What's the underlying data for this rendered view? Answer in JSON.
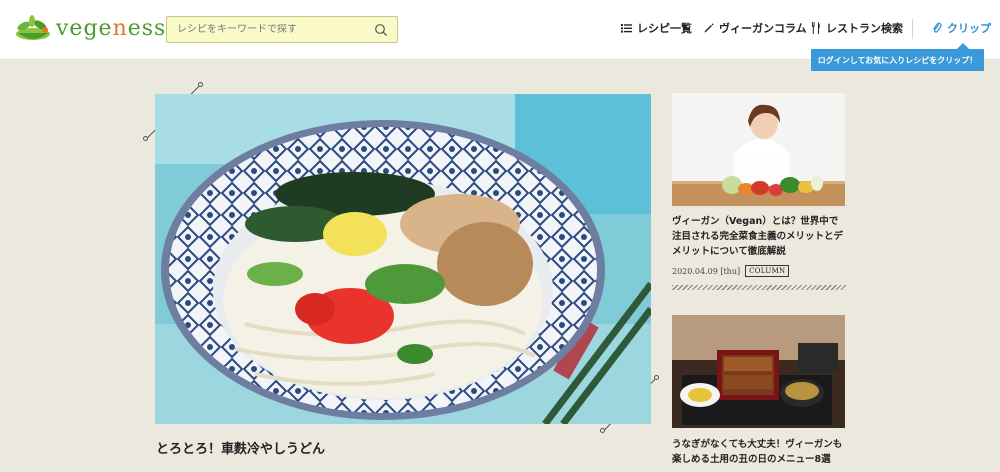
{
  "header": {
    "logo_text_prefix": "vege",
    "logo_text_accent": "n",
    "logo_text_suffix": "ess",
    "search_placeholder": "レシピをキーワードで探す",
    "nav": {
      "recipes": "レシピ一覧",
      "column": "ヴィーガンコラム",
      "restaurant": "レストラン検索",
      "clip": "クリップ"
    },
    "tooltip": "ログインしてお気に入りレシピをクリップ！"
  },
  "featured": {
    "title": "とろとろ！車麩冷やしうどん"
  },
  "side_articles": [
    {
      "title": "ヴィーガン（Vegan）とは？世界中で注目される完全菜食主義のメリットとデメリットについて徹底解説",
      "date": "2020.04.09 [thu]",
      "category": "COLUMN"
    },
    {
      "title": "うなぎがなくても大丈夫！ヴィーガンも楽しめる土用の丑の日のメニュー8選"
    }
  ],
  "colors": {
    "brand_green": "#4c9a2a",
    "brand_orange": "#e4762b",
    "accent_blue": "#3a9ad9",
    "page_bg": "#ebe8de",
    "search_bg": "#fafac9"
  },
  "icons": {
    "search": "search-icon",
    "recipes": "list-icon",
    "column": "pen-icon",
    "restaurant": "fork-knife-icon",
    "clip": "paperclip-icon"
  }
}
